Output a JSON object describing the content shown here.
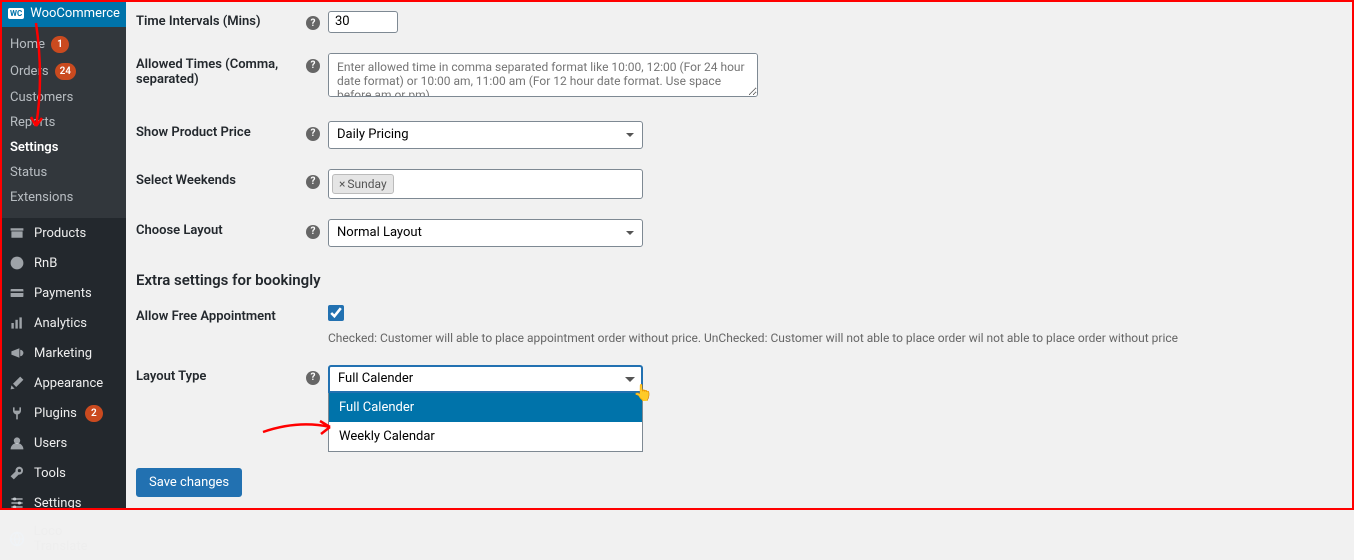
{
  "sidebar": {
    "title": "WooCommerce",
    "submenu": [
      {
        "label": "Home",
        "badge": "1"
      },
      {
        "label": "Orders",
        "badge": "24"
      },
      {
        "label": "Customers"
      },
      {
        "label": "Reports"
      },
      {
        "label": "Settings",
        "active": true
      },
      {
        "label": "Status"
      },
      {
        "label": "Extensions"
      }
    ],
    "items": [
      {
        "label": "Products",
        "icon": "archive"
      },
      {
        "label": "RnB",
        "icon": "rnb"
      },
      {
        "label": "Payments",
        "icon": "card"
      },
      {
        "label": "Analytics",
        "icon": "chart"
      },
      {
        "label": "Marketing",
        "icon": "megaphone"
      },
      {
        "label": "Appearance",
        "icon": "brush"
      },
      {
        "label": "Plugins",
        "icon": "plug",
        "badge": "2"
      },
      {
        "label": "Users",
        "icon": "user"
      },
      {
        "label": "Tools",
        "icon": "wrench"
      },
      {
        "label": "Settings",
        "icon": "sliders"
      },
      {
        "label": "Loco Translate",
        "icon": "globe"
      }
    ]
  },
  "form": {
    "timeIntervals": {
      "label": "Time Intervals (Mins)",
      "value": "30"
    },
    "allowedTimes": {
      "label": "Allowed Times (Comma, separated)",
      "placeholder": "Enter allowed time in comma separated format like 10:00, 12:00 (For 24 hour date format) or 10:00 am, 11:00 am (For 12 hour date format. Use space before am or pm)"
    },
    "productPrice": {
      "label": "Show Product Price",
      "value": "Daily Pricing"
    },
    "weekends": {
      "label": "Select Weekends",
      "tags": [
        "Sunday"
      ]
    },
    "layout": {
      "label": "Choose Layout",
      "value": "Normal Layout"
    },
    "section2": "Extra settings for bookingly",
    "freeAppt": {
      "label": "Allow Free Appointment",
      "desc": "Checked: Customer will able to place appointment order without price. UnChecked: Customer will not able to place order wil not able to place order without price"
    },
    "layoutType": {
      "label": "Layout Type",
      "value": "Full Calender",
      "options": [
        "Full Calender",
        "Weekly Calendar"
      ]
    },
    "save": "Save changes"
  }
}
